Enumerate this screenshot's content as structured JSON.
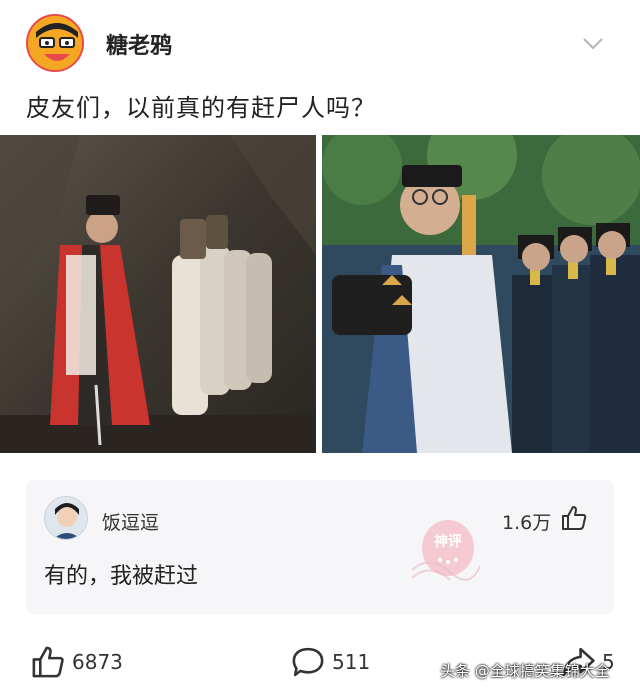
{
  "post": {
    "author": "糖老鸦",
    "text": "皮友们，以前真的有赶尸人吗？"
  },
  "comment": {
    "author": "饭逗逗",
    "likes": "1.6万",
    "text": "有的，我被赶过",
    "stamp_text": "神评"
  },
  "footer": {
    "likes": "6873",
    "comments": "511",
    "shares": "5"
  },
  "watermark": "头条 @全球搞笑集锦大全",
  "colors": {
    "accent_red": "#e8404f",
    "card_bg": "#f6f6f8"
  }
}
